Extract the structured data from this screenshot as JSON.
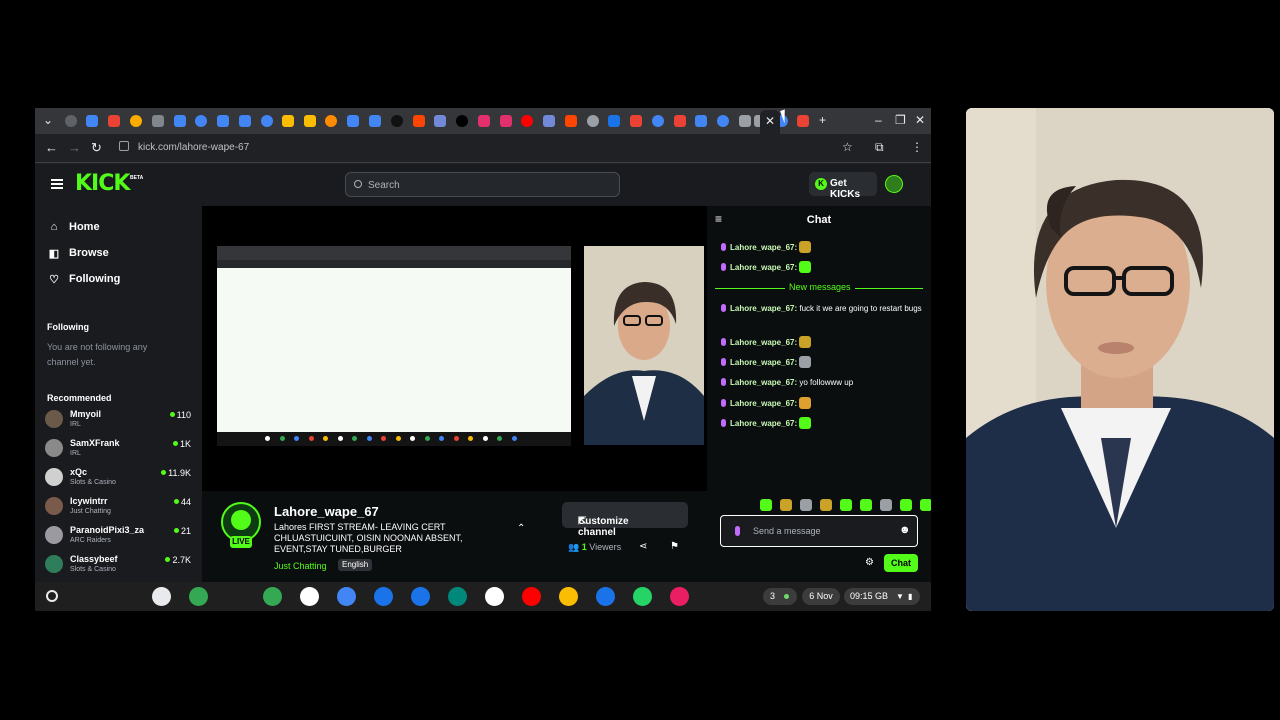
{
  "browser": {
    "url": "kick.com/lahore-wape-67",
    "tabs": [
      {
        "color": "#5f6368"
      },
      {
        "color": "#4285f4"
      },
      {
        "color": "#ea4335"
      },
      {
        "color": "#f9ab00"
      },
      {
        "color": "#80868b"
      },
      {
        "color": "#4285f4"
      },
      {
        "color": "#4285f4"
      },
      {
        "color": "#4285f4"
      },
      {
        "color": "#4285f4"
      },
      {
        "color": "#4285f4"
      },
      {
        "color": "#fbbc04"
      },
      {
        "color": "#fbbc04"
      },
      {
        "color": "#ff8c00"
      },
      {
        "color": "#4285f4"
      },
      {
        "color": "#4285f4"
      },
      {
        "color": "#111111"
      },
      {
        "color": "#ff4500"
      },
      {
        "color": "#7289da"
      },
      {
        "color": "#000000"
      },
      {
        "color": "#e1306c"
      },
      {
        "color": "#e1306c"
      },
      {
        "color": "#ff0000"
      },
      {
        "color": "#7289da"
      },
      {
        "color": "#ff4500"
      },
      {
        "color": "#9aa0a6"
      },
      {
        "color": "#1a73e8"
      },
      {
        "color": "#ea4335"
      },
      {
        "color": "#4285f4"
      },
      {
        "color": "#ea4335"
      },
      {
        "color": "#4285f4"
      },
      {
        "color": "#4285f4"
      },
      {
        "color": "#9aa0a6"
      },
      {
        "color": "#9aa0a6"
      },
      {
        "color": "#4285f4"
      },
      {
        "color": "#ea4335"
      }
    ]
  },
  "kick": {
    "logo": "KICK",
    "beta": "BETA",
    "search_placeholder": "Search",
    "get_kicks_label": "Get KICKs",
    "nav": [
      {
        "label": "Home",
        "icon": "home-icon",
        "glyph": "⌂"
      },
      {
        "label": "Browse",
        "icon": "browse-icon",
        "glyph": "◧"
      },
      {
        "label": "Following",
        "icon": "heart-icon",
        "glyph": "♡"
      }
    ],
    "following_heading": "Following",
    "not_following_text": "You are not following any channel yet.",
    "recommended_heading": "Recommended",
    "recommended": [
      {
        "name": "Mmyoil",
        "category": "IRL",
        "viewers": "110",
        "avatar_color": "#6b5a4a"
      },
      {
        "name": "SamXFrank",
        "category": "IRL",
        "viewers": "1K",
        "avatar_color": "#8a8a8a"
      },
      {
        "name": "xQc",
        "category": "Slots & Casino",
        "viewers": "11.9K",
        "avatar_color": "#d0d0d0"
      },
      {
        "name": "Icywintrr",
        "category": "Just Chatting",
        "viewers": "44",
        "avatar_color": "#7a5a4a"
      },
      {
        "name": "ParanoidPixi3_za",
        "category": "ARC Raiders",
        "viewers": "21",
        "avatar_color": "#9a9aa0"
      },
      {
        "name": "Classybeef",
        "category": "Slots & Casino",
        "viewers": "2.7K",
        "avatar_color": "#2e7d5b"
      }
    ],
    "stream": {
      "live_label": "LIVE",
      "streamer": "Lahore_wape_67",
      "title": "Lahores FIRST STREAM- LEAVING CERT CHLUASTUICUINT, OISIN NOONAN ABSENT, EVENT,STAY TUNED,BURGER",
      "category": "Just Chatting",
      "language": "English",
      "customize_label": "Customize channel",
      "viewer_count": "1",
      "viewer_label": "Viewers"
    },
    "chat": {
      "title": "Chat",
      "new_messages_label": "New messages",
      "messages_before": [
        {
          "user": "Lahore_wape_67:",
          "text": "",
          "emote_color": "#c9a227"
        },
        {
          "user": "Lahore_wape_67:",
          "text": "",
          "emote_color": "#53fc18"
        }
      ],
      "messages_after": [
        {
          "user": "Lahore_wape_67:",
          "text": "fuck it we are going to restart bugs",
          "emote_color": ""
        },
        {
          "user": "Lahore_wape_67:",
          "text": "",
          "emote_color": "#c9a227"
        },
        {
          "user": "Lahore_wape_67:",
          "text": "",
          "emote_color": "#9aa0a6"
        },
        {
          "user": "Lahore_wape_67:",
          "text": "yo followww up",
          "emote_color": ""
        },
        {
          "user": "Lahore_wape_67:",
          "text": "",
          "emote_color": "#e0a030"
        },
        {
          "user": "Lahore_wape_67:",
          "text": "",
          "emote_color": "#53fc18"
        }
      ],
      "input_placeholder": "Send a message",
      "send_label": "Chat"
    }
  },
  "shelf": {
    "apps": [
      {
        "name": "gemini-icon",
        "color": "#e8eaed"
      },
      {
        "name": "chrome-icon",
        "color": "#34a853"
      },
      {
        "name": "cast-icon",
        "color": "#1f1f1f"
      },
      {
        "name": "apps-grid-icon",
        "color": "#34a853"
      },
      {
        "name": "gmail-icon",
        "color": "#ffffff"
      },
      {
        "name": "calendar-icon",
        "color": "#4285f4"
      },
      {
        "name": "files-icon",
        "color": "#1a73e8"
      },
      {
        "name": "messages-icon",
        "color": "#1a73e8"
      },
      {
        "name": "meet-icon",
        "color": "#00897b"
      },
      {
        "name": "play-store-icon",
        "color": "#ffffff"
      },
      {
        "name": "youtube-icon",
        "color": "#ff0000"
      },
      {
        "name": "photos-icon",
        "color": "#fbbc04"
      },
      {
        "name": "camera-icon",
        "color": "#1a73e8"
      },
      {
        "name": "whatsapp-icon",
        "color": "#25d366"
      },
      {
        "name": "app-icon",
        "color": "#e91e63"
      }
    ],
    "notification_count": "3",
    "date": "6 Nov",
    "time": "09:15",
    "region": "GB"
  }
}
